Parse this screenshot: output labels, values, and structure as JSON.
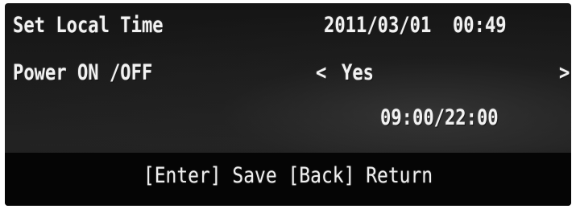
{
  "menu": {
    "rows": [
      {
        "label": "Set Local Time",
        "value": "2011/03/01  00:49"
      },
      {
        "label": "Power ON /OFF",
        "value_prefix": "<",
        "value": "Yes",
        "value_suffix": ">"
      },
      {
        "label": "",
        "value": "09:00/22:00"
      }
    ]
  },
  "footer": {
    "hint": "[Enter] Save [Back] Return"
  },
  "colors": {
    "text": "#f2f2f2",
    "background": "#1a1a1a",
    "footer_background": "#050505"
  }
}
